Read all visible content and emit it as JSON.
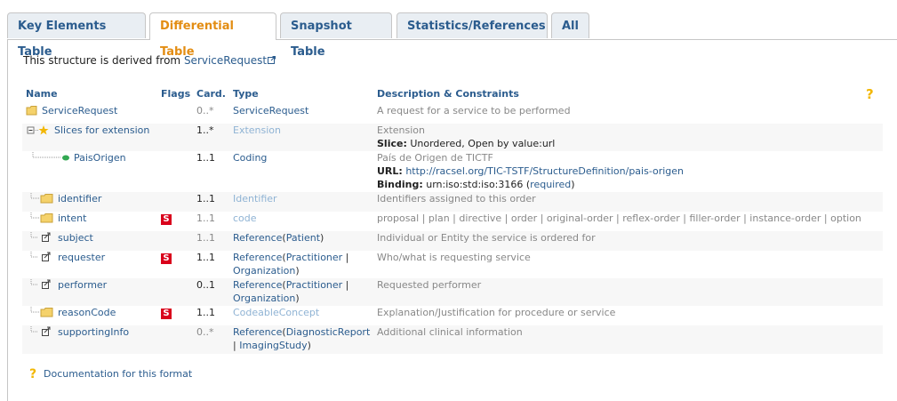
{
  "tabs": [
    {
      "label": "Key Elements Table",
      "active": false
    },
    {
      "label": "Differential Table",
      "active": true
    },
    {
      "label": "Snapshot Table",
      "active": false
    },
    {
      "label": "Statistics/References",
      "active": false
    },
    {
      "label": "All",
      "active": false
    }
  ],
  "derived": {
    "prefix": "This structure is derived from ",
    "link": "ServiceRequest"
  },
  "table": {
    "headers": {
      "name": "Name",
      "flags": "Flags",
      "card": "Card.",
      "type": "Type",
      "desc": "Description & Constraints"
    },
    "rows": [
      {
        "name": "ServiceRequest",
        "card": "0..*",
        "type1": "ServiceRequest",
        "desc1": "A request for a service to be performed"
      },
      {
        "name": "Slices for extension",
        "card": "1..*",
        "type1": "Extension",
        "desc1": "Extension",
        "desc2_label": "Slice:",
        "desc2_value": " Unordered, Open by value:url"
      },
      {
        "name": "PaisOrigen",
        "card": "1..1",
        "type1": "Coding",
        "desc1": "País de Origen de TICTF",
        "desc2_label": "URL:",
        "desc2_link": "http://racsel.org/TIC-TSTF/StructureDefinition/pais-origen",
        "desc3_label": "Binding:",
        "desc3_value": " urn:iso:std:iso:3166 (",
        "desc3_link": "required",
        "desc3_end": ")"
      },
      {
        "name": "identifier",
        "card": "1..1",
        "type1": "Identifier",
        "desc1": "Identifiers assigned to this order"
      },
      {
        "name": "intent",
        "flag": "S",
        "card": "1..1",
        "type1": "code",
        "desc1": "proposal | plan | directive | order | original-order | reflex-order | filler-order | instance-order | option"
      },
      {
        "name": "subject",
        "card": "1..1",
        "type1": "Reference",
        "type_open": "(",
        "type_arg1": "Patient",
        "type_close": ")",
        "desc1": "Individual or Entity the service is ordered for"
      },
      {
        "name": "requester",
        "flag": "S",
        "card": "1..1",
        "type1": "Reference",
        "type_open": "(",
        "type_arg1": "Practitioner",
        "type_sep": " |",
        "type_arg2": "Organization",
        "type_close": ")",
        "desc1": "Who/what is requesting service"
      },
      {
        "name": "performer",
        "card": "0..1",
        "type1": "Reference",
        "type_open": "(",
        "type_arg1": "Practitioner",
        "type_sep": " |",
        "type_arg2": "Organization",
        "type_close": ")",
        "desc1": "Requested performer"
      },
      {
        "name": "reasonCode",
        "flag": "S",
        "card": "1..1",
        "type1": "CodeableConcept",
        "desc1": "Explanation/Justification for procedure or service"
      },
      {
        "name": "supportingInfo",
        "card": "0..*",
        "type1": "Reference",
        "type_open": "(",
        "type_arg1": "DiagnosticReport",
        "type_sep2": "| ",
        "type_arg2": "ImagingStudy",
        "type_close": ")",
        "desc1": "Additional clinical information"
      }
    ]
  },
  "doc_link": "Documentation for this format",
  "colors": {
    "link": "#2b5c8e",
    "active_tab": "#e38d13",
    "flag": "#d9001b"
  }
}
